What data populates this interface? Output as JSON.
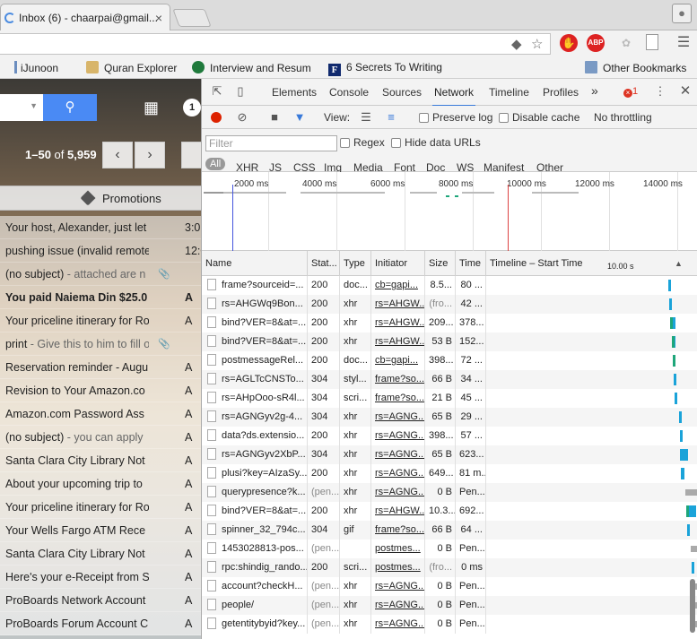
{
  "browser": {
    "tab_title": "Inbox (6) - chaarpai@gmail...",
    "tab_close": "×",
    "bookmarks": [
      {
        "label": "iJunoon",
        "icon": "ijunoon-icon"
      },
      {
        "label": "Quran Explorer",
        "icon": "quran-icon"
      },
      {
        "label": "Interview and Resum",
        "icon": "starbucks-icon"
      },
      {
        "label": "6 Secrets To Writing",
        "icon": "f-icon"
      }
    ],
    "other_bookmarks": "Other Bookmarks",
    "extension_abp": "ABP"
  },
  "gmail": {
    "notif_count": "1",
    "pagination": {
      "range": "1–50",
      "of": "of",
      "total": "5,959"
    },
    "promotions_label": "Promotions",
    "emails": [
      {
        "subject": "Your host, Alexander, just let",
        "snippet": "",
        "date": "3:0",
        "unread": false,
        "attachment": false
      },
      {
        "subject": "pushing issue (invalid remote",
        "snippet": "",
        "date": "12:0",
        "unread": false,
        "attachment": false
      },
      {
        "subject": "(no subject)",
        "snippet": " - attached are n",
        "date": "",
        "unread": false,
        "attachment": true
      },
      {
        "subject": "You paid Naiema Din $25.0",
        "snippet": "",
        "date": "A",
        "unread": true,
        "attachment": false
      },
      {
        "subject": "Your priceline itinerary for Ro",
        "snippet": "",
        "date": "A",
        "unread": false,
        "attachment": false
      },
      {
        "subject": "print",
        "snippet": " - Give this to him to fill o",
        "date": "",
        "unread": false,
        "attachment": true
      },
      {
        "subject": "Reservation reminder - Augu",
        "snippet": "",
        "date": "A",
        "unread": false,
        "attachment": false
      },
      {
        "subject": "Revision to Your Amazon.co",
        "snippet": "",
        "date": "A",
        "unread": false,
        "attachment": false
      },
      {
        "subject": "Amazon.com Password Ass",
        "snippet": "",
        "date": "A",
        "unread": false,
        "attachment": false
      },
      {
        "subject": "(no subject)",
        "snippet": " - you can apply",
        "date": "A",
        "unread": false,
        "attachment": false
      },
      {
        "subject": "Santa Clara City Library Not",
        "snippet": "",
        "date": "A",
        "unread": false,
        "attachment": false
      },
      {
        "subject": "About your upcoming trip to",
        "snippet": "",
        "date": "A",
        "unread": false,
        "attachment": false
      },
      {
        "subject": "Your priceline itinerary for Ro",
        "snippet": "",
        "date": "A",
        "unread": false,
        "attachment": false
      },
      {
        "subject": "Your Wells Fargo ATM Rece",
        "snippet": "",
        "date": "A",
        "unread": false,
        "attachment": false
      },
      {
        "subject": "Santa Clara City Library Not",
        "snippet": "",
        "date": "A",
        "unread": false,
        "attachment": false
      },
      {
        "subject": "Here's your e-Receipt from S",
        "snippet": "",
        "date": "A",
        "unread": false,
        "attachment": false
      },
      {
        "subject": "ProBoards Network Account",
        "snippet": "",
        "date": "A",
        "unread": false,
        "attachment": false
      },
      {
        "subject": "ProBoards Forum Account C",
        "snippet": "",
        "date": "A",
        "unread": false,
        "attachment": false
      }
    ]
  },
  "devtools": {
    "tabs": [
      "Elements",
      "Console",
      "Sources",
      "Network",
      "Timeline",
      "Profiles"
    ],
    "active_tab": "Network",
    "more": "»",
    "error_count": "1",
    "toolbar": {
      "view_label": "View:",
      "preserve_log": "Preserve log",
      "disable_cache": "Disable cache",
      "throttling": "No throttling"
    },
    "filter": {
      "placeholder": "Filter",
      "regex": "Regex",
      "hide_data_urls": "Hide data URLs",
      "types": [
        "All",
        "XHR",
        "JS",
        "CSS",
        "Img",
        "Media",
        "Font",
        "Doc",
        "WS",
        "Manifest",
        "Other"
      ]
    },
    "overview_ticks": [
      "2000 ms",
      "4000 ms",
      "6000 ms",
      "8000 ms",
      "10000 ms",
      "12000 ms",
      "14000 ms"
    ],
    "columns": [
      "Name",
      "Stat...",
      "Type",
      "Initiator",
      "Size",
      "Time",
      "Timeline – Start Time",
      "10.00 s"
    ],
    "requests": [
      {
        "name": "frame?sourceid=...",
        "status": "200",
        "type": "doc...",
        "initiator": "cb=gapi...",
        "size": "8.5...",
        "time": "80 ...",
        "wf_start": 0.86,
        "wf_len": 0.015,
        "color": "#1aa3d9"
      },
      {
        "name": "rs=AHGWq9Bon...",
        "status": "200",
        "type": "xhr",
        "initiator": "rs=AHGW...",
        "size": "(fro...",
        "time": "42 ...",
        "wf_start": 0.865,
        "wf_len": 0.01,
        "color": "#1aa3d9"
      },
      {
        "name": "bind?VER=8&at=...",
        "status": "200",
        "type": "xhr",
        "initiator": "rs=AHGW...",
        "size": "209...",
        "time": "378...",
        "wf_start": 0.87,
        "wf_len": 0.025,
        "color": "#1aa3d9",
        "green": true
      },
      {
        "name": "bind?VER=8&at=...",
        "status": "200",
        "type": "xhr",
        "initiator": "rs=AHGW...",
        "size": "53 B",
        "time": "152...",
        "wf_start": 0.875,
        "wf_len": 0.02,
        "color": "#1aa3d9",
        "green": true
      },
      {
        "name": "postmessageRel...",
        "status": "200",
        "type": "doc...",
        "initiator": "cb=gapi...",
        "size": "398...",
        "time": "72 ...",
        "wf_start": 0.88,
        "wf_len": 0.015,
        "color": "#1aa3d9",
        "green": true
      },
      {
        "name": "rs=AGLTcCNSTo...",
        "status": "304",
        "type": "styl...",
        "initiator": "frame?so...",
        "size": "66 B",
        "time": "34 ...",
        "wf_start": 0.885,
        "wf_len": 0.01,
        "color": "#1aa3d9"
      },
      {
        "name": "rs=AHpOoo-sR4l...",
        "status": "304",
        "type": "scri...",
        "initiator": "frame?so...",
        "size": "21 B",
        "time": "45 ...",
        "wf_start": 0.89,
        "wf_len": 0.012,
        "color": "#1aa3d9"
      },
      {
        "name": "rs=AGNGyv2g-4...",
        "status": "304",
        "type": "xhr",
        "initiator": "rs=AGNG...",
        "size": "65 B",
        "time": "29 ...",
        "wf_start": 0.91,
        "wf_len": 0.01,
        "color": "#1aa3d9"
      },
      {
        "name": "data?ds.extensio...",
        "status": "200",
        "type": "xhr",
        "initiator": "rs=AGNG...",
        "size": "398...",
        "time": "57 ...",
        "wf_start": 0.915,
        "wf_len": 0.012,
        "color": "#1aa3d9"
      },
      {
        "name": "rs=AGNGyv2XbP...",
        "status": "304",
        "type": "xhr",
        "initiator": "rs=AGNG...",
        "size": "65 B",
        "time": "623...",
        "wf_start": 0.915,
        "wf_len": 0.04,
        "color": "#1aa3d9"
      },
      {
        "name": "plusi?key=AIzaSy...",
        "status": "200",
        "type": "xhr",
        "initiator": "rs=AGNG...",
        "size": "649...",
        "time": "81 m...",
        "wf_start": 0.92,
        "wf_len": 0.015,
        "color": "#1aa3d9"
      },
      {
        "name": "querypresence?k...",
        "status": "(pen...",
        "type": "xhr",
        "initiator": "rs=AGNG...",
        "size": "0 B",
        "time": "Pen...",
        "wf_start": 0.94,
        "wf_len": 0.06,
        "color": "#aaaaaa"
      },
      {
        "name": "bind?VER=8&at=...",
        "status": "200",
        "type": "xhr",
        "initiator": "rs=AHGW...",
        "size": "10.3...",
        "time": "692...",
        "wf_start": 0.945,
        "wf_len": 0.045,
        "color": "#1aa3d9",
        "green": true
      },
      {
        "name": "spinner_32_794c...",
        "status": "304",
        "type": "gif",
        "initiator": "frame?so...",
        "size": "66 B",
        "time": "64 ...",
        "wf_start": 0.95,
        "wf_len": 0.012,
        "color": "#1aa3d9"
      },
      {
        "name": "1453028813-pos...",
        "status": "(pen...",
        "type": "",
        "initiator": "postmes...",
        "size": "0 B",
        "time": "Pen...",
        "wf_start": 0.965,
        "wf_len": 0.035,
        "color": "#aaaaaa"
      },
      {
        "name": "rpc:shindig_rando...",
        "status": "200",
        "type": "scri...",
        "initiator": "postmes...",
        "size": "(fro...",
        "time": "0 ms",
        "wf_start": 0.97,
        "wf_len": 0.008,
        "color": "#1aa3d9"
      },
      {
        "name": "account?checkH...",
        "status": "(pen...",
        "type": "xhr",
        "initiator": "rs=AGNG...",
        "size": "0 B",
        "time": "Pen...",
        "wf_start": 0.975,
        "wf_len": 0.025,
        "color": "#aaaaaa"
      },
      {
        "name": "people/",
        "status": "(pen...",
        "type": "xhr",
        "initiator": "rs=AGNG...",
        "size": "0 B",
        "time": "Pen...",
        "wf_start": 0.98,
        "wf_len": 0.02,
        "color": "#aaaaaa"
      },
      {
        "name": "getentitybyid?key...",
        "status": "(pen...",
        "type": "xhr",
        "initiator": "rs=AGNG...",
        "size": "0 B",
        "time": "Pen...",
        "wf_start": 0.985,
        "wf_len": 0.015,
        "color": "#aaaaaa"
      }
    ]
  }
}
